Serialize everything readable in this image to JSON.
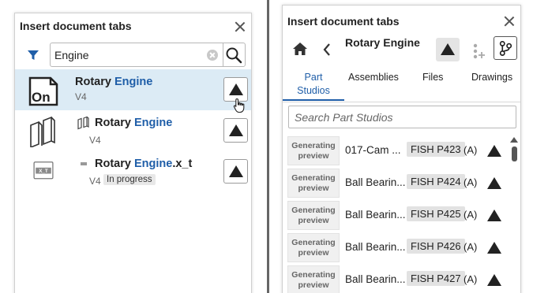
{
  "left_dialog": {
    "title": "Insert document tabs",
    "search": {
      "value": "Engine"
    },
    "results": [
      {
        "prefix": "Rotary ",
        "match": "Engine",
        "suffix": "",
        "version": "V4",
        "selected": true
      },
      {
        "prefix": "Rotary ",
        "match": "Engine",
        "suffix": "",
        "version": "V4",
        "selected": false
      },
      {
        "prefix": "Rotary ",
        "match": "Engine",
        "suffix": ".x_t",
        "version": "V4",
        "status": "In progress",
        "selected": false
      }
    ]
  },
  "right_dialog": {
    "title": "Insert document tabs",
    "nav_title": "Rotary Engine",
    "tabs": [
      {
        "label": "Part\nStudios",
        "active": true
      },
      {
        "label": "Assemblies",
        "active": false
      },
      {
        "label": "Files",
        "active": false
      },
      {
        "label": "Drawings",
        "active": false
      }
    ],
    "search_placeholder": "Search Part Studios",
    "items": [
      {
        "thumb": "Generating preview",
        "name": "017-Cam ...",
        "part": "FISH P423",
        "rev": "(A)"
      },
      {
        "thumb": "Generating preview",
        "name": "Ball Bearin...",
        "part": "FISH P424",
        "rev": "(A)"
      },
      {
        "thumb": "Generating preview",
        "name": "Ball Bearin...",
        "part": "FISH P425",
        "rev": "(A)"
      },
      {
        "thumb": "Generating preview",
        "name": "Ball Bearin...",
        "part": "FISH P426",
        "rev": "(A)"
      },
      {
        "thumb": "Generating preview",
        "name": "Ball Bearin...",
        "part": "FISH P427",
        "rev": "(A)"
      }
    ]
  },
  "colors": {
    "accent": "#1f5ea8",
    "selected_row": "#dcebf5"
  }
}
